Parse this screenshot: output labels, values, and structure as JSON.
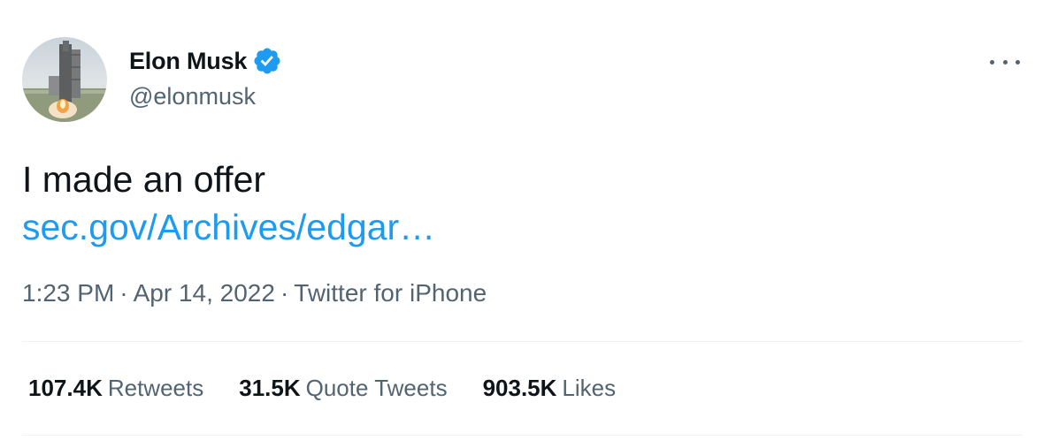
{
  "author": {
    "display_name": "Elon Musk",
    "handle": "@elonmusk",
    "verified": true,
    "avatar_icon": "rocket-launch-avatar"
  },
  "tweet": {
    "text": "I made an offer",
    "link_text": "sec.gov/Archives/edgar…"
  },
  "meta": {
    "time": "1:23 PM",
    "date": "Apr 14, 2022",
    "source": "Twitter for iPhone",
    "separator": "·"
  },
  "stats": {
    "retweets_count": "107.4K",
    "retweets_label": "Retweets",
    "quote_count": "31.5K",
    "quote_label": "Quote Tweets",
    "likes_count": "903.5K",
    "likes_label": "Likes"
  },
  "colors": {
    "link": "#1d9bf0",
    "secondary_text": "#536471",
    "primary_text": "#0f1419",
    "divider": "#eff3f4"
  }
}
